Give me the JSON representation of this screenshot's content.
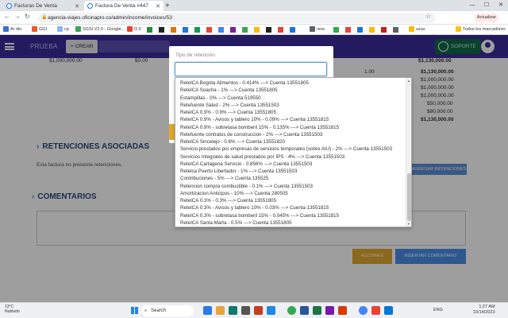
{
  "browser": {
    "tabs": [
      {
        "title": "Facturas De Venta"
      },
      {
        "title": "Factura De Venta #447"
      }
    ],
    "url": "agencia-viajes.oficinapro.co/admin/income/invoices/53",
    "update_label": "Actualizar",
    "bookmarks": [
      "Ar dio",
      "GGI",
      "cp",
      "SGSI V2.0 - Google...",
      "O.0",
      "new",
      "uzas",
      "Todos los marcadores"
    ]
  },
  "app": {
    "brand": "PRUEBA",
    "create_label": "+ CREAR",
    "support_label": "SOPORTE"
  },
  "invoice": {
    "top_row": {
      "subtotal": "$1,000,000.00",
      "discount": "$0.00",
      "total": "$1,130,000.00",
      "qty": "1.00",
      "line_total": "$1,130,000.00"
    },
    "summary": [
      "$1,000,000.00",
      "$1,000,000.00",
      "$1,000,000.00",
      "$50,000.00",
      "$80,000.00",
      "$1,130,000.00"
    ]
  },
  "retenciones": {
    "title": "RETENCIONES ASOCIADAS",
    "empty_note": "Esta factura no presenta retenciones.",
    "add_label": "AGREGAR RETENCIONES"
  },
  "comentarios": {
    "title": "COMENTARIOS",
    "actions_label": "ACCIONES",
    "insert_label": "INSERTAR COMENTARIO"
  },
  "modal": {
    "label": "Tipo de retención",
    "selected_value": "",
    "options": [
      "ReteICA Bogota Alimentos - 0.414% ---> Cuenta 13551805",
      "ReteICA Soacha - 1% ---> Cuenta 13551805",
      "Estampillas - 0% ---> Cuenta 519550",
      "Retefuente Salud - 2% ---> Cuenta 13551503",
      "ReteICA 0.9% - 0.9% ---> Cuenta 13551805",
      "ReteICA 0.9% - Avisos y tablero 10% - 0.09% ---> Cuenta 13551815",
      "ReteICA 0.9% - sobretasa bomberil 15% - 0.135% ---> Cuenta 13551815",
      "Retefuente contratos de construccion - 2% ---> Cuenta 13551503",
      "ReteICA Sincelejo - 0.6% ---> Cuenta 13551820",
      "Servicio prestados por empresas de servicios temporales (sobre AIU) - 2% ---> Cuenta 13551503",
      "Servicios Integrales de salud prestados por IPS - 4% ---> Cuenta 13551503",
      "ReteICA Cartagena Servicio - 0.856% ---> Cuenta 13551503",
      "Retelca Puerto Libertador - 1% ---> Cuenta 13551503",
      "Contribuciones - 5% ---> Cuenta 135525",
      "Retencion compra combustible - 0.1% ---> Cuenta 13551503",
      "Amortizacion Anticipos - 10% ---> Cuenta 280505",
      "ReteICA 0.3% - 0.3% ---> Cuenta 13551805",
      "ReteICA 0.3% - Avisos y tablero 10% - 0.03% ---> Cuenta 13551815",
      "ReteICA 0.3% - sobretasa bomberil 15% - 0.045% ---> Cuenta 13551815",
      "ReteICA Santa Marta - 0.5% ---> Cuenta 13551805"
    ]
  },
  "taskbar": {
    "weather_temp": "13°C",
    "weather_desc": "Nublado",
    "search_label": "Search",
    "lang": "ENG",
    "time": "1:27 AM",
    "date": "10/14/2023"
  },
  "colors": {
    "navbar": "#3b2a9c",
    "section_title": "#2c4a78",
    "primary_button": "#4a8de8",
    "warning_button": "#e0a82e",
    "support_button": "#0f6a4a"
  }
}
